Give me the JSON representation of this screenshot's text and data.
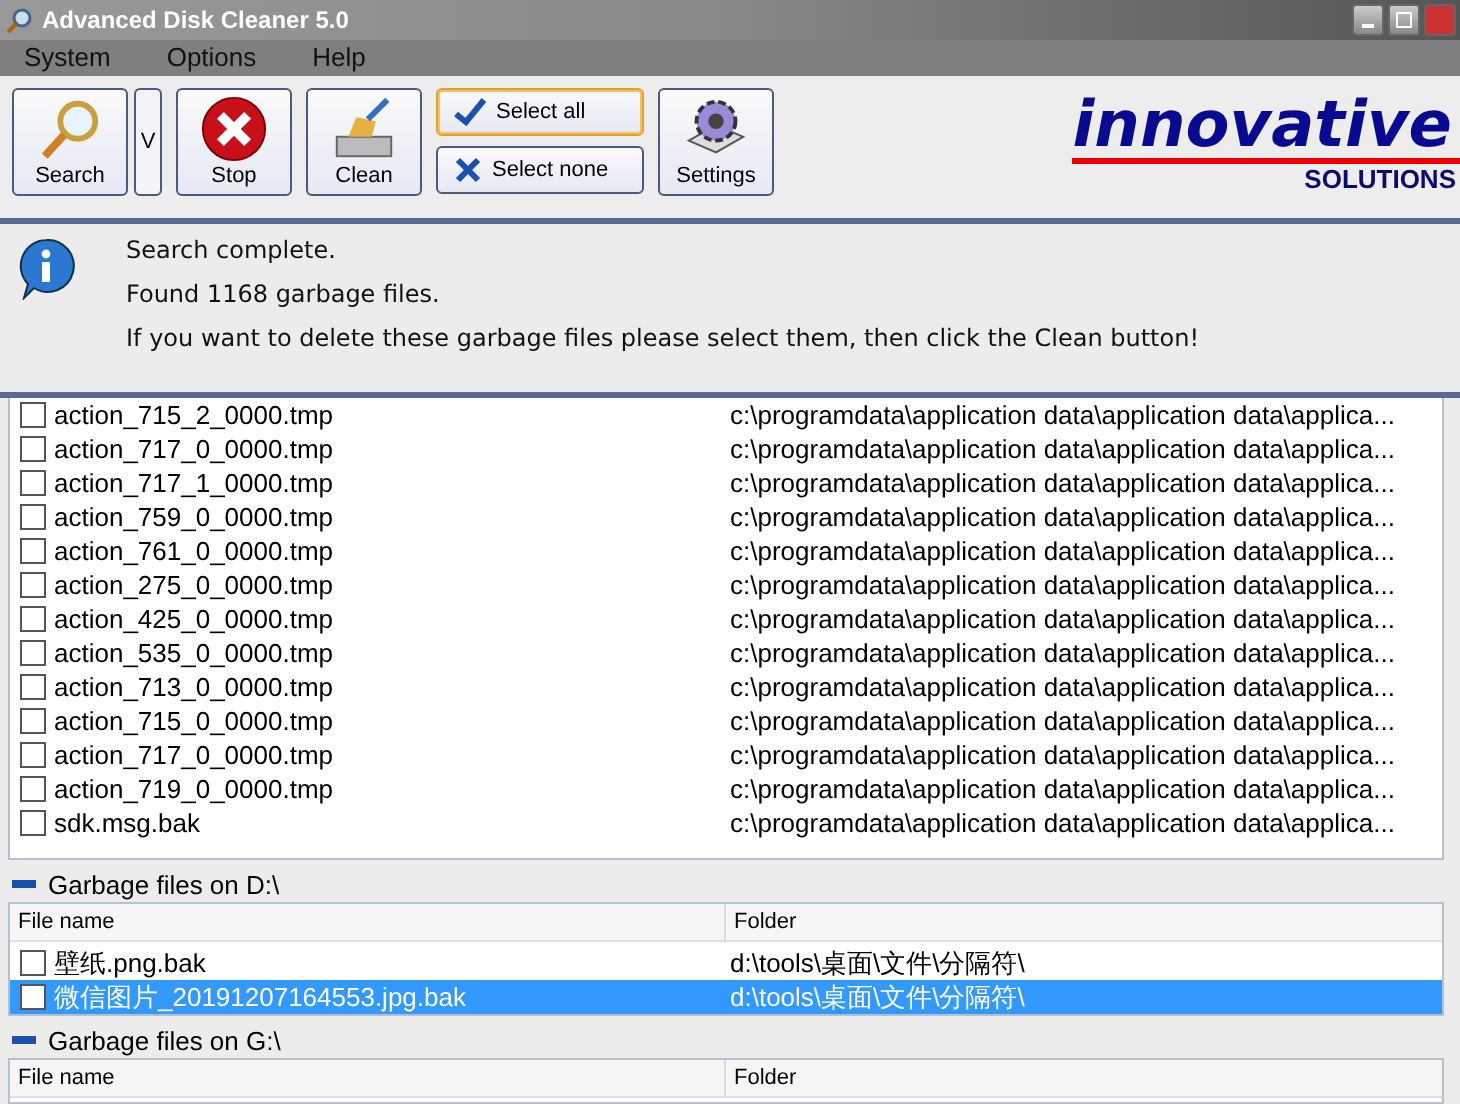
{
  "window": {
    "title": "Advanced Disk Cleaner 5.0"
  },
  "menu": [
    "System",
    "Options",
    "Help"
  ],
  "toolbar": [
    {
      "kind": "search",
      "label": "Search"
    },
    {
      "kind": "dropdown",
      "label": "V"
    },
    {
      "kind": "stop",
      "label": "Stop"
    },
    {
      "kind": "clean",
      "label": "Clean"
    },
    {
      "kind": "select",
      "label": "Select all",
      "focused": true
    },
    {
      "kind": "selectnone",
      "label": "Select none",
      "focused": false
    },
    {
      "kind": "settings",
      "label": "Settings"
    }
  ],
  "logo": {
    "name": "innovative",
    "tagline": "SOLUTIONS"
  },
  "info": [
    "Search complete.",
    "Found 1168 garbage files.",
    "If you want to delete these garbage files please select them, then click the Clean button!"
  ],
  "groups": [
    {
      "rows": [
        {
          "name": "action_715_2_0000.tmp",
          "folder": "c:\\programdata\\application data\\application data\\applica...",
          "checked": false,
          "selected": false
        },
        {
          "name": "action_717_0_0000.tmp",
          "folder": "c:\\programdata\\application data\\application data\\applica...",
          "checked": false,
          "selected": false
        },
        {
          "name": "action_717_1_0000.tmp",
          "folder": "c:\\programdata\\application data\\application data\\applica...",
          "checked": false,
          "selected": false
        },
        {
          "name": "action_759_0_0000.tmp",
          "folder": "c:\\programdata\\application data\\application data\\applica...",
          "checked": false,
          "selected": false
        },
        {
          "name": "action_761_0_0000.tmp",
          "folder": "c:\\programdata\\application data\\application data\\applica...",
          "checked": false,
          "selected": false
        },
        {
          "name": "action_275_0_0000.tmp",
          "folder": "c:\\programdata\\application data\\application data\\applica...",
          "checked": false,
          "selected": false
        },
        {
          "name": "action_425_0_0000.tmp",
          "folder": "c:\\programdata\\application data\\application data\\applica...",
          "checked": false,
          "selected": false
        },
        {
          "name": "action_535_0_0000.tmp",
          "folder": "c:\\programdata\\application data\\application data\\applica...",
          "checked": false,
          "selected": false
        },
        {
          "name": "action_713_0_0000.tmp",
          "folder": "c:\\programdata\\application data\\application data\\applica...",
          "checked": false,
          "selected": false
        },
        {
          "name": "action_715_0_0000.tmp",
          "folder": "c:\\programdata\\application data\\application data\\applica...",
          "checked": false,
          "selected": false
        },
        {
          "name": "action_717_0_0000.tmp",
          "folder": "c:\\programdata\\application data\\application data\\applica...",
          "checked": false,
          "selected": false
        },
        {
          "name": "action_719_0_0000.tmp",
          "folder": "c:\\programdata\\application data\\application data\\applica...",
          "checked": false,
          "selected": false
        },
        {
          "name": "sdk.msg.bak",
          "folder": "c:\\programdata\\application data\\application data\\applica...",
          "checked": false,
          "selected": false
        }
      ]
    },
    {
      "title": "Garbage files on D:\\",
      "columns": [
        "File name",
        "Folder"
      ],
      "rows": [
        {
          "name": "壁纸.png.bak",
          "folder": "d:\\tools\\桌面\\文件\\分隔符\\",
          "checked": false,
          "selected": false
        },
        {
          "name": "微信图片_20191207164553.jpg.bak",
          "folder": "d:\\tools\\桌面\\文件\\分隔符\\",
          "checked": false,
          "selected": true
        }
      ]
    },
    {
      "title": "Garbage files on G:\\",
      "columns": [
        "File name",
        "Folder"
      ]
    }
  ]
}
